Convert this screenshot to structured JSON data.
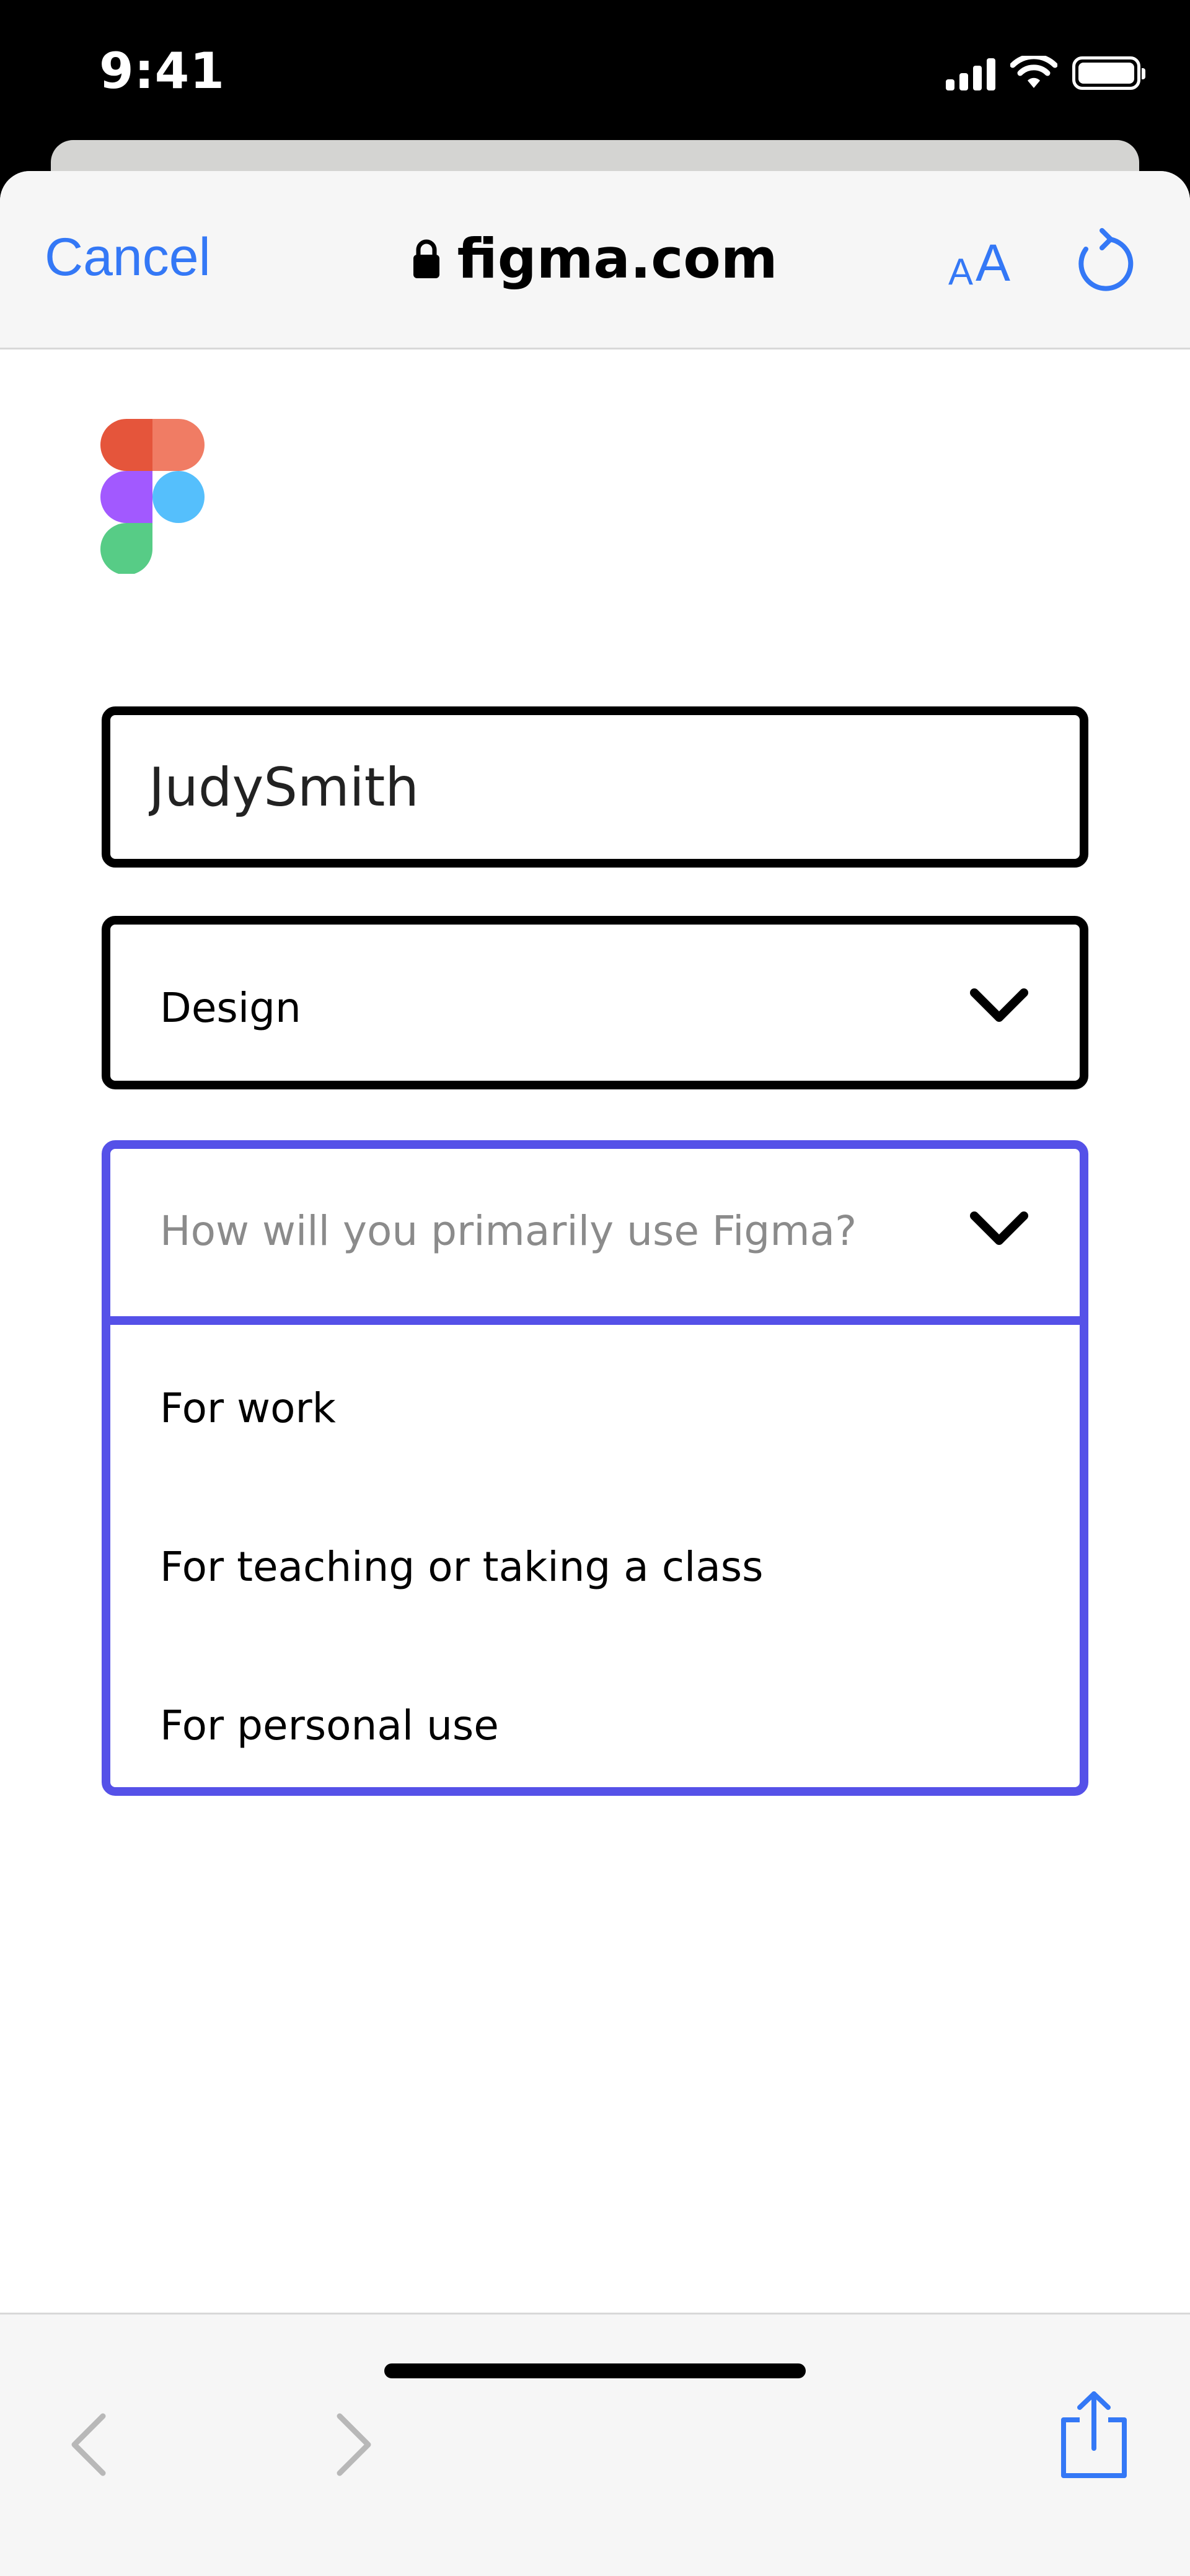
{
  "status_bar": {
    "time": "9:41",
    "icons": [
      "signal-icon",
      "wifi-icon",
      "battery-icon"
    ]
  },
  "browser": {
    "cancel_label": "Cancel",
    "domain": "figma.com",
    "reader_label": {
      "small": "A",
      "big": "A"
    },
    "accent_color": "#3478f6",
    "icons": [
      "lock-icon",
      "reload-icon",
      "back-icon",
      "forward-icon",
      "share-icon"
    ]
  },
  "form": {
    "name_value": "JudySmith",
    "role_value": "Design",
    "use_placeholder": "How will you primarily use Figma?",
    "use_options": [
      "For work",
      "For teaching or taking a class",
      "For personal use"
    ],
    "focus_color": "#5551e8"
  },
  "logo": {
    "name": "figma-logo",
    "colors": [
      "#e5553b",
      "#f07c64",
      "#a259ff",
      "#55bffc",
      "#57cc86"
    ]
  }
}
